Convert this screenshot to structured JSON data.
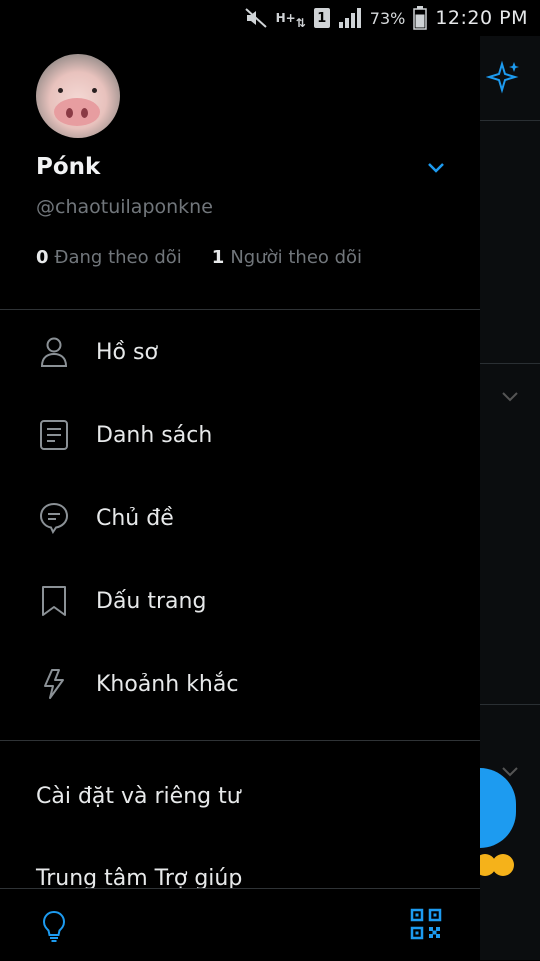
{
  "status_bar": {
    "battery": "73%",
    "time": "12:20 PM",
    "network": "H+",
    "sim": "1"
  },
  "profile": {
    "display_name": "Pónk",
    "handle": "@chaotuilaponkne",
    "following_count": "0",
    "following_label": "Đang theo dõi",
    "followers_count": "1",
    "followers_label": "Người theo dõi"
  },
  "menu": {
    "items": [
      {
        "label": "Hồ sơ",
        "icon": "person-icon"
      },
      {
        "label": "Danh sách",
        "icon": "list-icon"
      },
      {
        "label": "Chủ đề",
        "icon": "topics-icon"
      },
      {
        "label": "Dấu trang",
        "icon": "bookmark-icon"
      },
      {
        "label": "Khoảnh khắc",
        "icon": "lightning-icon"
      }
    ],
    "settings_label": "Cài đặt và riêng tư",
    "help_label": "Trung tâm Trợ giúp"
  },
  "colors": {
    "accent": "#1d9bf0",
    "background": "#000000",
    "text": "#e7e9ea",
    "secondary_text": "#71767b",
    "divider": "#2f3336"
  }
}
